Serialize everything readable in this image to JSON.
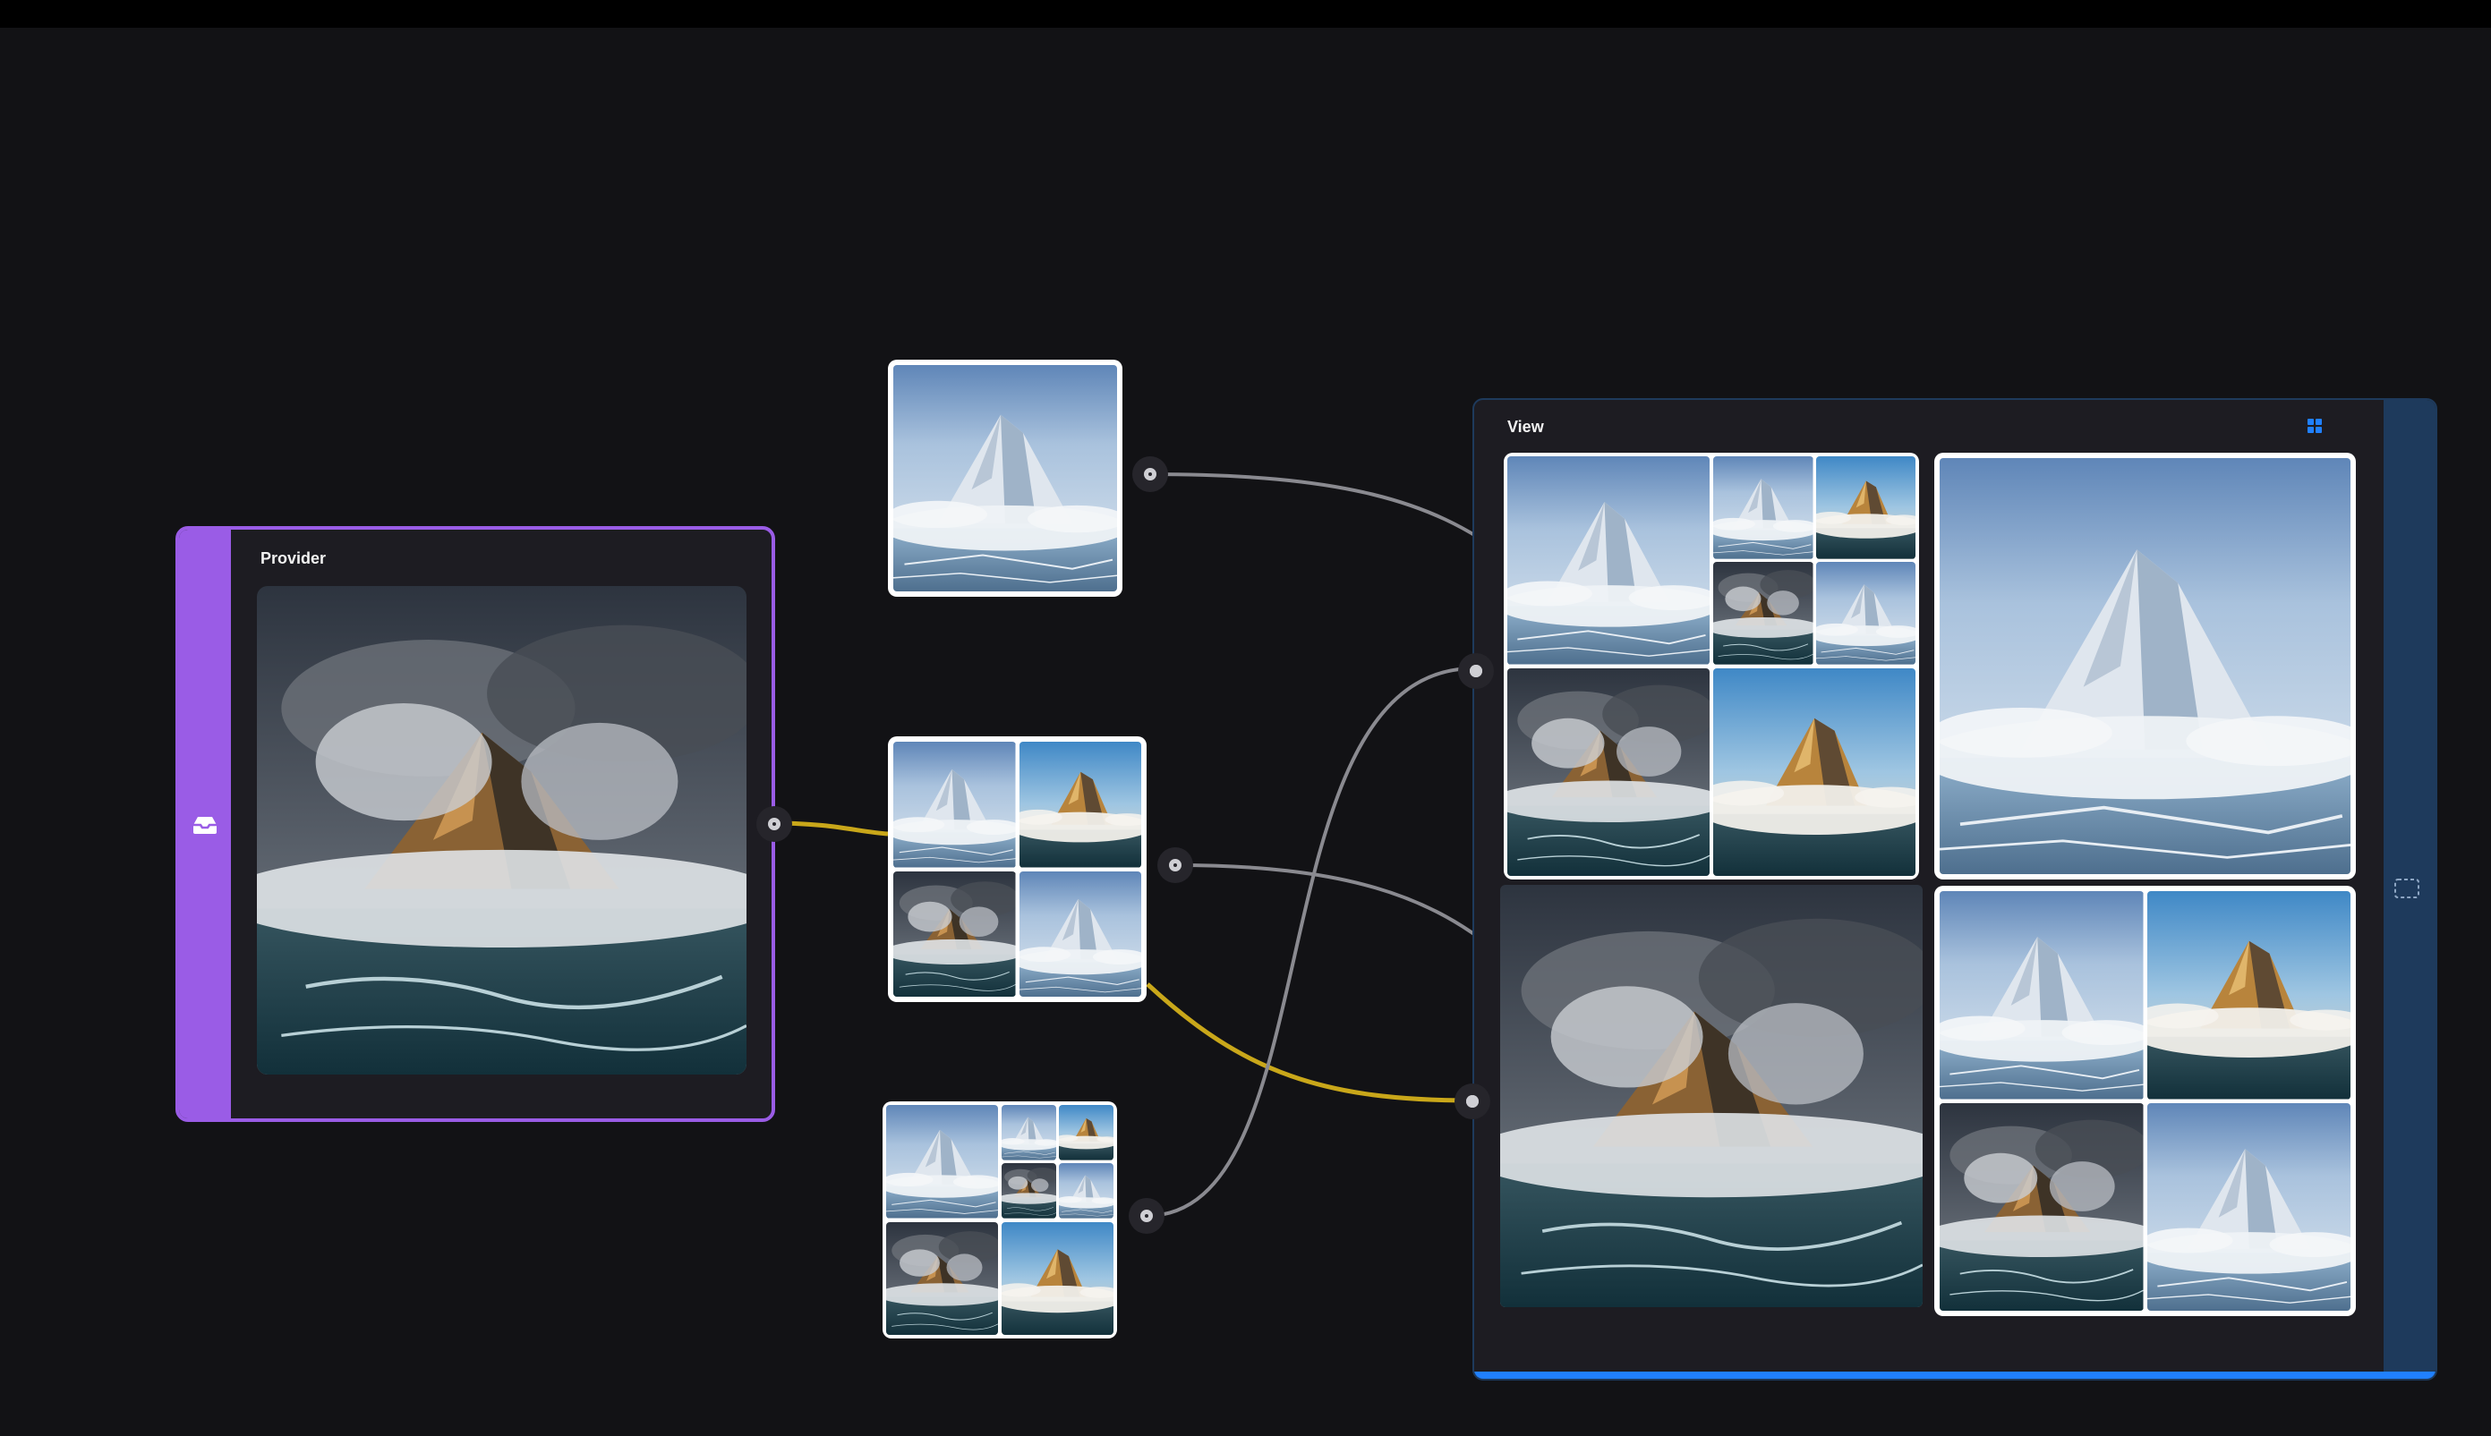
{
  "canvas": {
    "background": "#121215",
    "top_bar_color": "#000000",
    "wire_colors": {
      "default": "#8a8a90",
      "active": "#c9a71a"
    }
  },
  "provider_node": {
    "title": "Provider",
    "accent_color": "#9a5ce6",
    "icon": "inbox-tray-icon",
    "image": "stormy-mountain-photo"
  },
  "source_nodes": [
    {
      "layout": "single",
      "images": [
        "snowy-peak"
      ]
    },
    {
      "layout": "2x2",
      "images": [
        "snowy-peak",
        "golden-peak",
        "stormy-peak",
        "snowy-peak"
      ]
    },
    {
      "layout": "nested",
      "images": [
        "snowy-peak",
        "snowy-peak",
        "golden-peak",
        "stormy-peak",
        "snowy-peak",
        "stormy-peak",
        "golden-peak"
      ]
    }
  ],
  "view_node": {
    "title": "View",
    "accent_color": "#2080ff",
    "header_icon": "grid-layout-icon",
    "side_icon": "selection-frame-icon"
  }
}
